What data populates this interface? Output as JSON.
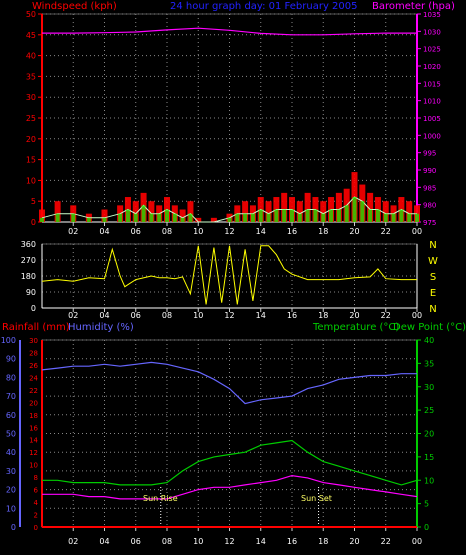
{
  "header": {
    "left_label": "Windspeed (kph)",
    "title": "24 hour graph day: 01 February 2005",
    "right_label": "Barometer (hpa)"
  },
  "lower_header": {
    "rainfall_label": "Rainfall (mm)",
    "humidity_label": "Humidity (%)",
    "temperature_label": "Temperature (°C)",
    "dewpoint_label": "Dew Point (°C)"
  },
  "annotations": {
    "sunrise": "Sun Rise",
    "sunset": "Sun Set"
  },
  "colors": {
    "wind": "#ff0000",
    "gust": "#ff0000",
    "avg": "#00ff00",
    "baro": "#ff00ff",
    "dir": "#ffff00",
    "temp": "#00cc00",
    "dew": "#ff00ff",
    "hum": "#6666ff",
    "rain": "#ff0000",
    "grid": "#888888",
    "axis_red": "#ff0000"
  },
  "chart_data": [
    {
      "type": "line",
      "name": "wind-baro",
      "xlabels": [
        "02",
        "04",
        "06",
        "08",
        "10",
        "12",
        "14",
        "16",
        "18",
        "20",
        "22",
        "00"
      ],
      "xlim": [
        0,
        24
      ],
      "wind_ylim": [
        0,
        50
      ],
      "wind_ticks": [
        0,
        5,
        10,
        15,
        20,
        25,
        30,
        35,
        40,
        45,
        50
      ],
      "baro_ylim": [
        975,
        1035
      ],
      "baro_ticks": [
        975,
        980,
        985,
        990,
        995,
        1000,
        1005,
        1010,
        1015,
        1020,
        1025,
        1030,
        1035
      ],
      "grid": true,
      "series": [
        {
          "key": "gust",
          "x": [
            0,
            1,
            2,
            3,
            4,
            5,
            5.5,
            6,
            6.5,
            7,
            7.5,
            8,
            8.5,
            9,
            9.5,
            10,
            11,
            12,
            12.5,
            13,
            13.5,
            14,
            14.5,
            15,
            15.5,
            16,
            16.5,
            17,
            17.5,
            18,
            18.5,
            19,
            19.5,
            20,
            20.5,
            21,
            21.5,
            22,
            22.5,
            23,
            23.5,
            24
          ],
          "y": [
            3,
            5,
            4,
            2,
            3,
            4,
            6,
            5,
            7,
            5,
            4,
            6,
            4,
            3,
            5,
            1,
            1,
            2,
            4,
            5,
            4,
            6,
            5,
            6,
            7,
            6,
            5,
            7,
            6,
            5,
            6,
            7,
            8,
            12,
            9,
            7,
            6,
            5,
            4,
            6,
            5,
            4
          ]
        },
        {
          "key": "wind",
          "x": [
            0,
            1,
            2,
            3,
            4,
            5,
            5.5,
            6,
            6.5,
            7,
            7.5,
            8,
            8.5,
            9,
            9.5,
            10,
            11,
            12,
            12.5,
            13,
            13.5,
            14,
            14.5,
            15,
            15.5,
            16,
            16.5,
            17,
            17.5,
            18,
            18.5,
            19,
            19.5,
            20,
            20.5,
            21,
            21.5,
            22,
            22.5,
            23,
            23.5,
            24
          ],
          "y": [
            1,
            2,
            2,
            1,
            1,
            2,
            3,
            2,
            4,
            2,
            2,
            3,
            2,
            1,
            2,
            0,
            0,
            1,
            2,
            2,
            2,
            3,
            2,
            3,
            3,
            3,
            2,
            3,
            3,
            2,
            3,
            3,
            4,
            6,
            5,
            3,
            3,
            2,
            2,
            3,
            2,
            2
          ]
        },
        {
          "key": "baro",
          "x": [
            0,
            2,
            4,
            6,
            8,
            10,
            12,
            14,
            16,
            18,
            20,
            22,
            24
          ],
          "y": [
            1029.5,
            1029.5,
            1029.6,
            1029.8,
            1030.4,
            1030.9,
            1030.3,
            1029.4,
            1029.0,
            1029.0,
            1029.3,
            1029.5,
            1029.5
          ]
        }
      ]
    },
    {
      "type": "scatter",
      "name": "wind-direction",
      "xlabels": [
        "02",
        "04",
        "06",
        "08",
        "10",
        "12",
        "14",
        "16",
        "18",
        "20",
        "22",
        "00"
      ],
      "xlim": [
        0,
        24
      ],
      "ylim": [
        0,
        360
      ],
      "yticks": [
        0,
        90,
        180,
        270,
        360
      ],
      "compass": [
        "N",
        "W",
        "S",
        "E",
        "N"
      ],
      "series": [
        {
          "key": "dir",
          "x": [
            0,
            1,
            2,
            3,
            4,
            4.5,
            5,
            5.3,
            6,
            7,
            7.5,
            8,
            8.5,
            9,
            9.5,
            10,
            10.5,
            11,
            11.5,
            12,
            12.5,
            13,
            13.5,
            14,
            14.5,
            15,
            15.5,
            16,
            17,
            18,
            19,
            20,
            21,
            21.5,
            22,
            23,
            24
          ],
          "y": [
            150,
            160,
            150,
            170,
            165,
            330,
            180,
            120,
            160,
            180,
            170,
            170,
            165,
            175,
            80,
            350,
            20,
            340,
            30,
            350,
            20,
            330,
            40,
            350,
            350,
            300,
            220,
            190,
            160,
            160,
            160,
            170,
            175,
            220,
            165,
            160,
            160
          ]
        }
      ]
    },
    {
      "type": "line",
      "name": "temp-humidity-rain",
      "xlabels": [
        "02",
        "04",
        "06",
        "08",
        "10",
        "12",
        "14",
        "16",
        "18",
        "20",
        "22",
        "00"
      ],
      "xlim": [
        0,
        24
      ],
      "humidity_ylim": [
        0,
        100
      ],
      "humidity_ticks": [
        0,
        10,
        20,
        30,
        40,
        50,
        60,
        70,
        80,
        90,
        100
      ],
      "rain_ylim": [
        0,
        30
      ],
      "rain_ticks": [
        0,
        2,
        4,
        6,
        8,
        10,
        12,
        14,
        16,
        18,
        20,
        22,
        24,
        26,
        28,
        30
      ],
      "temp_ylim": [
        0,
        40
      ],
      "temp_ticks": [
        0,
        5,
        10,
        15,
        20,
        25,
        30,
        35,
        40
      ],
      "sunrise_x": 7.6,
      "sunset_x": 17.7,
      "grid": true,
      "series": [
        {
          "key": "hum",
          "x": [
            0,
            1,
            2,
            3,
            4,
            5,
            6,
            7,
            8,
            9,
            10,
            11,
            12,
            12.5,
            13,
            13.5,
            14,
            15,
            16,
            17,
            18,
            19,
            20,
            21,
            22,
            23,
            24
          ],
          "y": [
            84,
            85,
            86,
            86,
            87,
            86,
            87,
            88,
            87,
            85,
            83,
            79,
            74,
            70,
            66,
            67,
            68,
            69,
            70,
            74,
            76,
            79,
            80,
            81,
            81,
            82,
            82
          ]
        },
        {
          "key": "temp",
          "x": [
            0,
            1,
            2,
            3,
            4,
            5,
            6,
            7,
            8,
            9,
            10,
            11,
            12,
            13,
            14,
            15,
            16,
            17,
            18,
            19,
            20,
            21,
            22,
            23,
            24
          ],
          "y": [
            10,
            10,
            9.5,
            9.5,
            9.5,
            9,
            9,
            9,
            9.5,
            12,
            14,
            15,
            15.5,
            16,
            17.5,
            18,
            18.5,
            16,
            14,
            13,
            12,
            11,
            10,
            9,
            10
          ]
        },
        {
          "key": "dew",
          "x": [
            0,
            1,
            2,
            3,
            4,
            5,
            6,
            7,
            8,
            9,
            10,
            11,
            12,
            13,
            14,
            15,
            16,
            17,
            18,
            19,
            20,
            21,
            22,
            23,
            24
          ],
          "y": [
            7,
            7,
            7,
            6.5,
            6.5,
            6,
            6,
            6,
            6,
            7,
            8,
            8.5,
            8.5,
            9,
            9.5,
            10,
            11,
            10.5,
            9.5,
            9,
            8.5,
            8,
            7.5,
            7,
            6.5
          ]
        },
        {
          "key": "rain",
          "x": [
            0,
            24
          ],
          "y": [
            0,
            0
          ]
        }
      ]
    }
  ]
}
